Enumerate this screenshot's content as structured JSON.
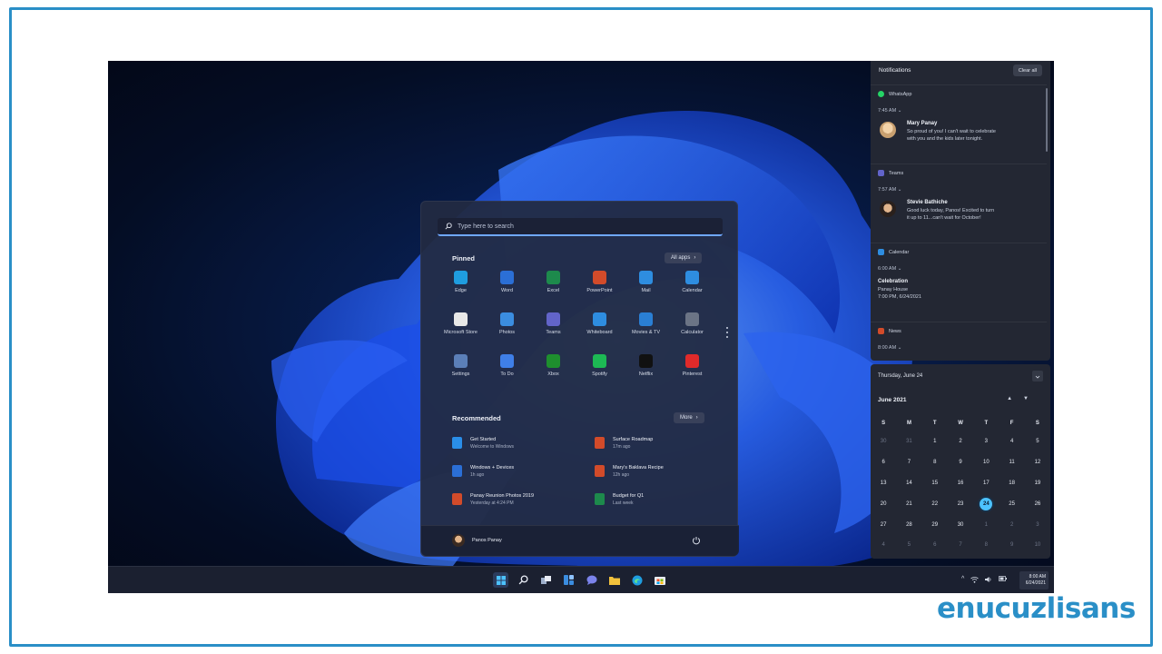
{
  "start_menu": {
    "search_placeholder": "Type here to search",
    "pinned_title": "Pinned",
    "all_apps_label": "All apps",
    "pinned_apps": [
      {
        "label": "Edge",
        "icon": "edge-icon",
        "color": "#1f9de0"
      },
      {
        "label": "Word",
        "icon": "word-icon",
        "color": "#2b6fd6"
      },
      {
        "label": "Excel",
        "icon": "excel-icon",
        "color": "#1d8a4c"
      },
      {
        "label": "PowerPoint",
        "icon": "powerpoint-icon",
        "color": "#d24b2a"
      },
      {
        "label": "Mail",
        "icon": "mail-icon",
        "color": "#2e8de0"
      },
      {
        "label": "Calendar",
        "icon": "calendar-icon",
        "color": "#2e8de0"
      },
      {
        "label": "Microsoft Store",
        "icon": "store-icon",
        "color": "#e8e8e8"
      },
      {
        "label": "Photos",
        "icon": "photos-icon",
        "color": "#3b8de0"
      },
      {
        "label": "Teams",
        "icon": "teams-icon",
        "color": "#6264c9"
      },
      {
        "label": "Whiteboard",
        "icon": "whiteboard-icon",
        "color": "#2e8de0"
      },
      {
        "label": "Movies & TV",
        "icon": "movies-icon",
        "color": "#2a7fd4"
      },
      {
        "label": "Calculator",
        "icon": "calculator-icon",
        "color": "#6b7485"
      },
      {
        "label": "Settings",
        "icon": "gear-icon",
        "color": "#5b7fb8"
      },
      {
        "label": "To Do",
        "icon": "todo-icon",
        "color": "#3f7fe8"
      },
      {
        "label": "Xbox",
        "icon": "xbox-icon",
        "color": "#1e8f2e"
      },
      {
        "label": "Spotify",
        "icon": "spotify-icon",
        "color": "#1db954"
      },
      {
        "label": "Netflix",
        "icon": "netflix-icon",
        "color": "#111111"
      },
      {
        "label": "Pinterest",
        "icon": "pinterest-icon",
        "color": "#e02a2a"
      }
    ],
    "recommended_title": "Recommended",
    "more_label": "More",
    "recommended": [
      {
        "title": "Get Started",
        "subtitle": "Welcome to Windows",
        "icon": "get-started-icon",
        "color": "#2a8ee8"
      },
      {
        "title": "Surface Roadmap",
        "subtitle": "17m ago",
        "icon": "pdf-icon",
        "color": "#d24b2a"
      },
      {
        "title": "Windows + Devices",
        "subtitle": "1h ago",
        "icon": "word-doc-icon",
        "color": "#2b6fd6"
      },
      {
        "title": "Mary's Baklava Recipe",
        "subtitle": "12h ago",
        "icon": "pdf-icon",
        "color": "#d24b2a"
      },
      {
        "title": "Panay Reunion Photos 2019",
        "subtitle": "Yesterday at 4:24 PM",
        "icon": "powerpoint-doc-icon",
        "color": "#d24b2a"
      },
      {
        "title": "Budget for Q1",
        "subtitle": "Last week",
        "icon": "excel-doc-icon",
        "color": "#1d8a4c"
      }
    ],
    "user_name": "Panos Panay"
  },
  "notifications": {
    "title": "Notifications",
    "clear_all": "Clear all",
    "items": [
      {
        "app": "WhatsApp",
        "time": "7:45 AM",
        "sender": "Mary Panay",
        "message_1": "So proud of you! I can't wait to celebrate",
        "message_2": "with you and the kids later tonight.",
        "app_color": "#25d366"
      },
      {
        "app": "Teams",
        "time": "7:57 AM",
        "sender": "Stevie Bathiche",
        "message_1": "Good luck today, Panos! Excited to turn",
        "message_2": "it up to 11...can't wait for October!",
        "app_color": "#6264c9"
      },
      {
        "app": "Calendar",
        "time": "6:00 AM",
        "sender": "Celebration",
        "message_1": "Panay House",
        "message_2": "7:00 PM, 6/24/2021",
        "app_color": "#2e8de0"
      },
      {
        "app": "News",
        "time": "8:00 AM",
        "app_color": "#d24b2a"
      }
    ]
  },
  "calendar": {
    "day_header": "Thursday, June 24",
    "month": "June 2021",
    "weekdays": [
      "S",
      "M",
      "T",
      "W",
      "T",
      "F",
      "S"
    ],
    "days": [
      "30",
      "31",
      "1",
      "2",
      "3",
      "4",
      "5",
      "6",
      "7",
      "8",
      "9",
      "10",
      "11",
      "12",
      "13",
      "14",
      "15",
      "16",
      "17",
      "18",
      "19",
      "20",
      "21",
      "22",
      "23",
      "24",
      "25",
      "26",
      "27",
      "28",
      "29",
      "30",
      "1",
      "2",
      "3",
      "4",
      "5",
      "6",
      "7",
      "8",
      "9",
      "10"
    ],
    "today": "24"
  },
  "taskbar": {
    "icons": [
      "windows-start-icon",
      "search-icon",
      "task-view-icon",
      "widgets-icon",
      "chat-icon",
      "file-explorer-icon",
      "edge-icon",
      "store-icon"
    ],
    "time": "8:00 AM",
    "date": "6/24/2021"
  },
  "brand": "enucuzlisans",
  "colors": {
    "frame": "#2a8fc7",
    "accent": "#4cc2ff"
  }
}
